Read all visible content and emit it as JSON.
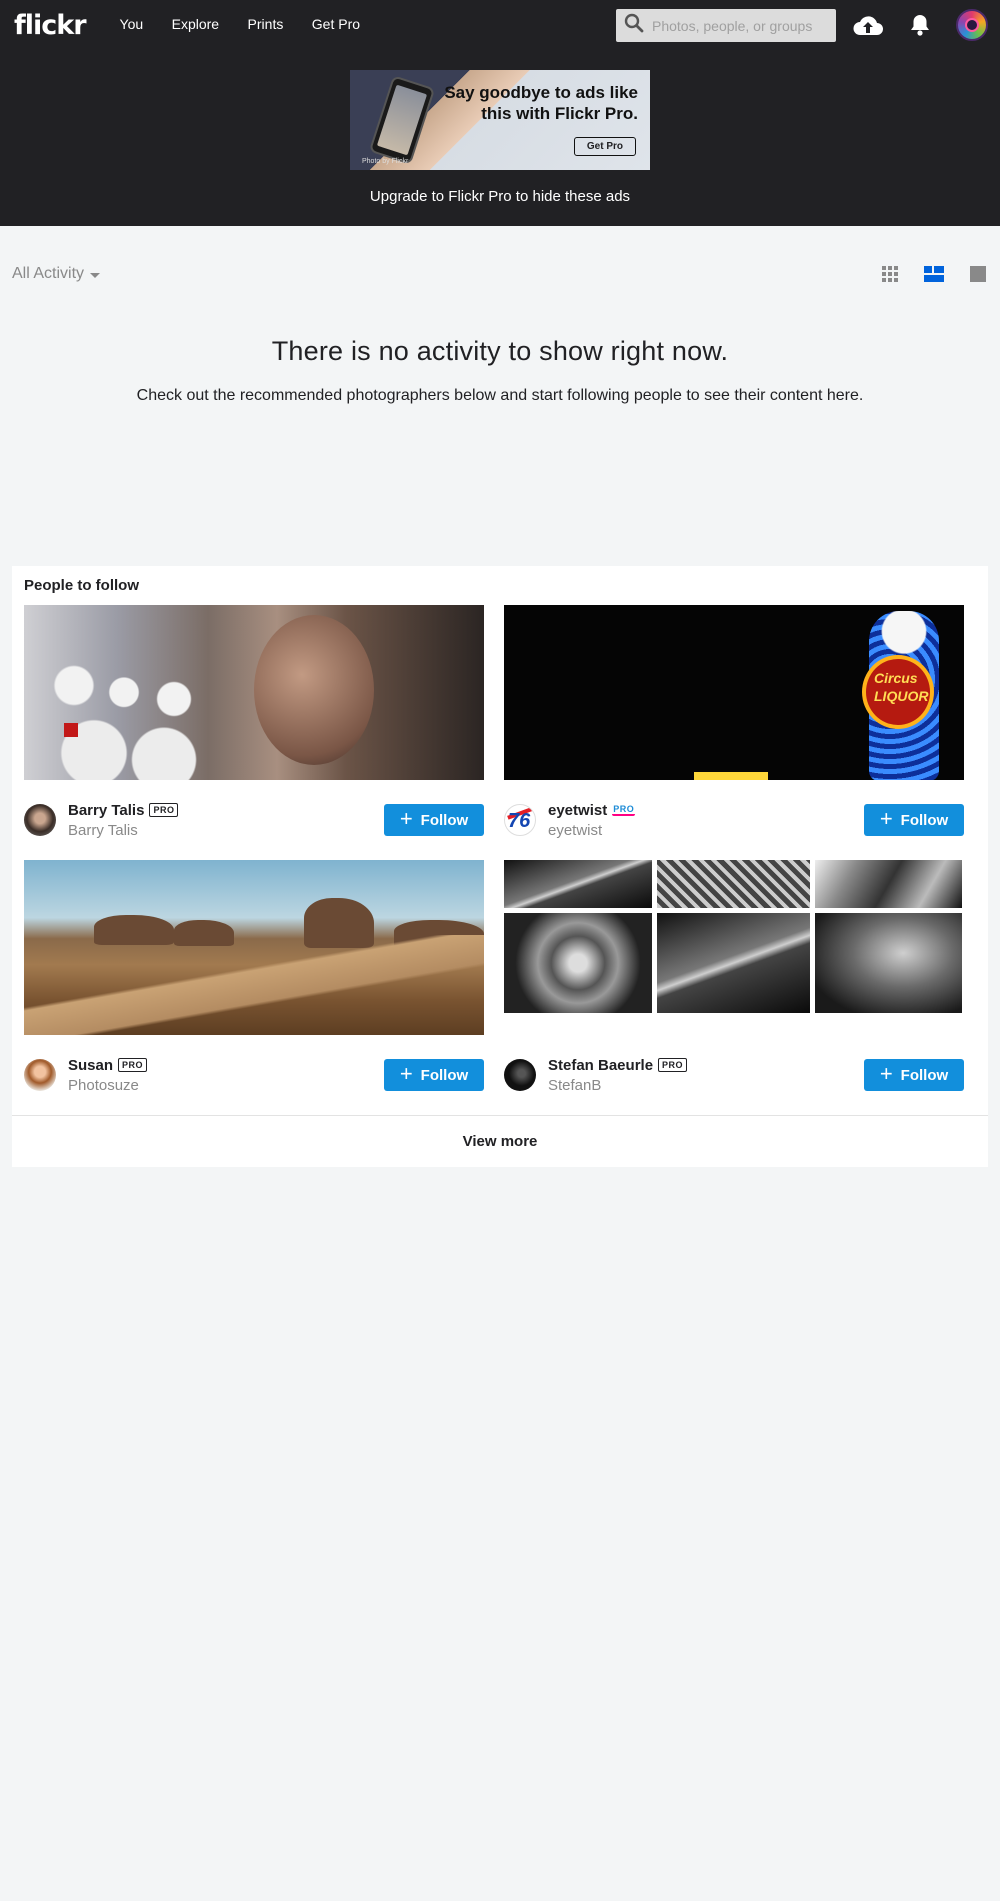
{
  "header": {
    "logo": "flickr",
    "nav": [
      "You",
      "Explore",
      "Prints",
      "Get Pro"
    ],
    "search_placeholder": "Photos, people, or groups",
    "icons": [
      "upload-cloud-icon",
      "bell-icon",
      "user-avatar"
    ]
  },
  "ad": {
    "headline_line1": "Say goodbye to ads like",
    "headline_line2": "this with Flickr Pro.",
    "button": "Get Pro",
    "credit": "Photo by Flickr",
    "upgrade_text": "Upgrade to Flickr Pro to hide these ads"
  },
  "activity": {
    "filter_label": "All Activity",
    "views": [
      "grid-view-icon",
      "magazine-view-icon",
      "single-view-icon"
    ],
    "active_view": "magazine-view-icon",
    "empty_title": "There is no activity to show right now.",
    "empty_text": "Check out the recommended photographers below and start following people to see their content here."
  },
  "people_to_follow": {
    "title": "People to follow",
    "people": [
      {
        "name": "Barry Talis",
        "username": "Barry Talis",
        "pro": "PRO",
        "follow_label": "Follow"
      },
      {
        "name": "eyetwist",
        "username": "eyetwist",
        "pro": "PRO",
        "follow_label": "Follow",
        "avatar_text": "76"
      },
      {
        "name": "Susan",
        "username": "Photosuze",
        "pro": "PRO",
        "follow_label": "Follow"
      },
      {
        "name": "Stefan Baeurle",
        "username": "StefanB",
        "pro": "PRO",
        "follow_label": "Follow"
      }
    ],
    "cover_texts": {
      "neon_sign": "Circus LIQUOR"
    },
    "view_more": "View more"
  },
  "colors": {
    "topbar": "#212124",
    "follow_button": "#128fdc",
    "active_view": "#0063dc",
    "pro_accent": "#ff0084"
  }
}
